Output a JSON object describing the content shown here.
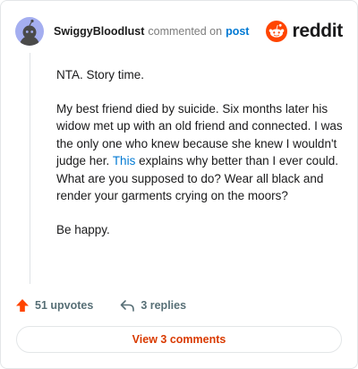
{
  "header": {
    "username": "SwiggyBloodlust",
    "action_text": "commented on",
    "post_link": "post",
    "brand": "reddit"
  },
  "comment": {
    "p1": "NTA. Story time.",
    "p2_before": "My best friend died by suicide. Six months later his widow met up with an old friend and connected. I was the only one who knew because she knew I wouldn't judge her. ",
    "p2_link": "This",
    "p2_after": " explains why better than I ever could. What are you supposed to do? Wear all black and render your garments crying on the moors?",
    "p3": "Be happy."
  },
  "footer": {
    "upvotes": "51 upvotes",
    "replies": "3 replies"
  },
  "cta": {
    "label": "View 3 comments"
  },
  "colors": {
    "accent_orange": "#ff4500",
    "link_blue": "#0079d3",
    "cta_text": "#d93a00",
    "avatar_bg": "#a4aef0"
  },
  "icons": [
    "default-avatar-icon",
    "reddit-logo-icon",
    "upvote-arrow-icon",
    "reply-icon"
  ]
}
